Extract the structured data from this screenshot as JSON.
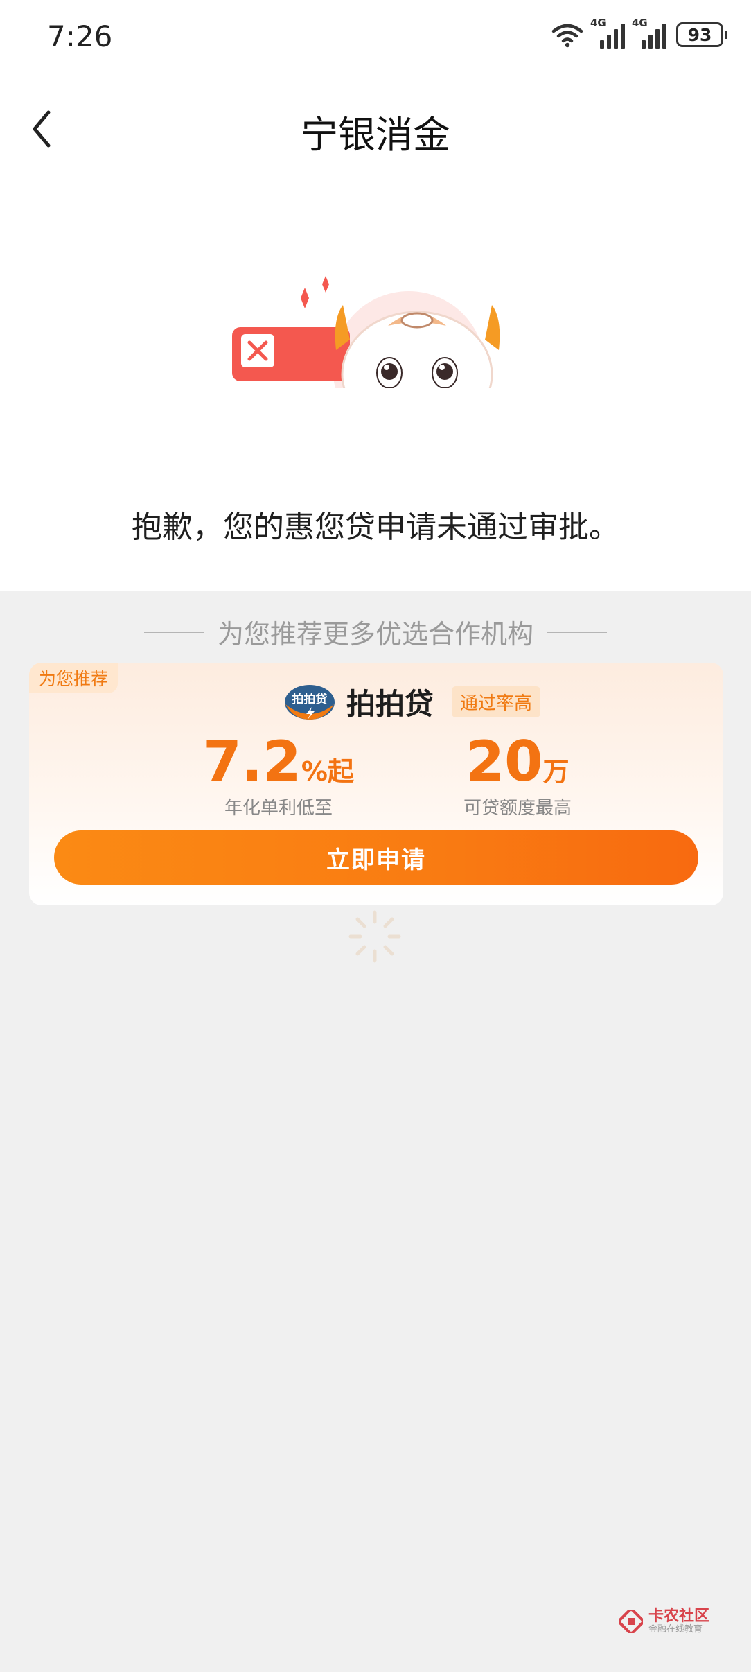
{
  "status_bar": {
    "time": "7:26",
    "network_label_1": "4G",
    "network_label_2": "4G",
    "battery_level": "93"
  },
  "header": {
    "title": "宁银消金",
    "back_icon": "chevron-left-icon"
  },
  "result": {
    "message": "抱歉，您的惠您贷申请未通过审批。",
    "illustration": "mascot-rejected-illustration"
  },
  "recommendation": {
    "heading": "为您推荐更多优选合作机构",
    "card": {
      "tag": "为您推荐",
      "brand_name": "拍拍贷",
      "logo_text": "拍拍贷",
      "badge": "通过率高",
      "rate_value": "7.2",
      "rate_unit": "%起",
      "rate_label": "年化单利低至",
      "amount_value": "20",
      "amount_unit": "万",
      "amount_label": "可贷额度最高",
      "apply_label": "立即申请"
    }
  },
  "watermark": {
    "title": "卡农社区",
    "subtitle": "金融在线教育"
  },
  "colors": {
    "accent": "#f37312",
    "button_start": "#fb8a14",
    "button_end": "#f86a10",
    "background": "#f0f0f0"
  }
}
